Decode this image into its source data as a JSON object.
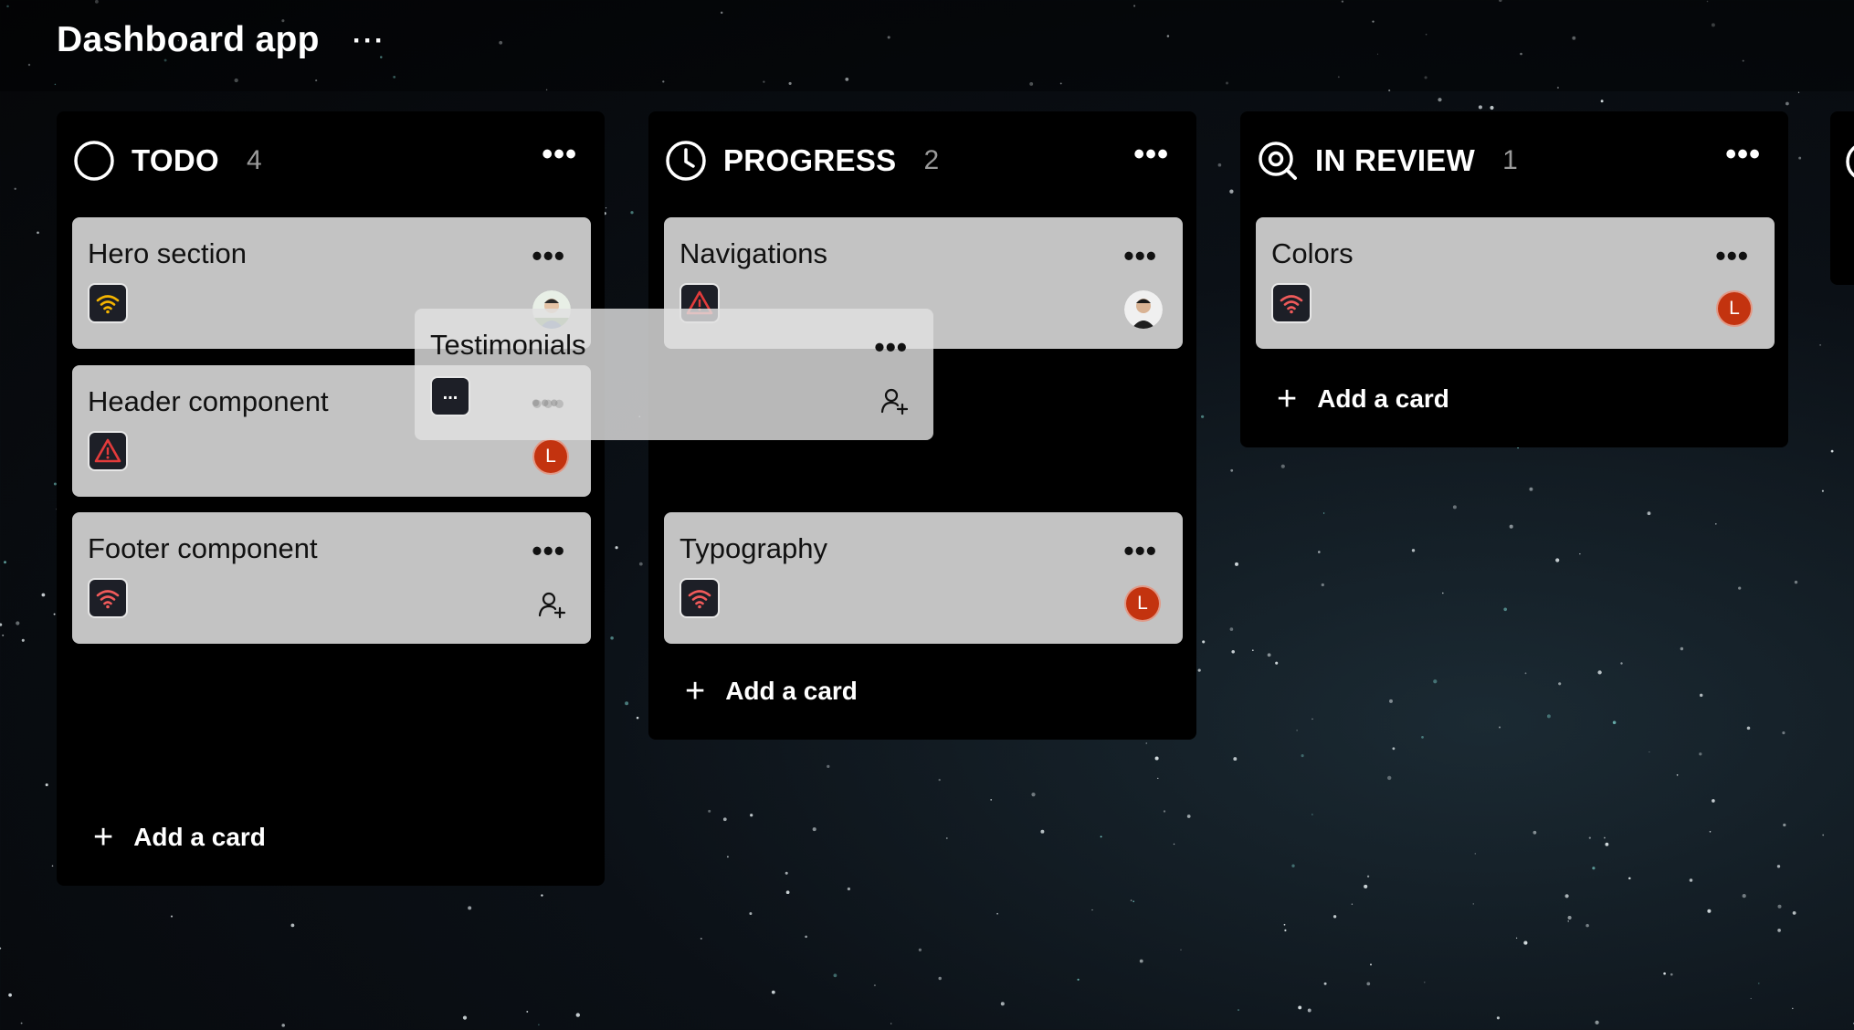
{
  "app": {
    "title": "Dashboard app",
    "more": "···"
  },
  "columns": [
    {
      "name": "TODO",
      "count": "4",
      "icon": "circle-icon",
      "more": "•••",
      "add_label": "Add a card",
      "plus": "+",
      "cards": [
        {
          "title": "Hero section",
          "icon": "wifi-icon",
          "icon_color": "#f4b400",
          "more": "•••",
          "assignee": "photo"
        },
        {
          "title": "Header component",
          "icon": "warning-icon",
          "icon_color": "#e33b3b",
          "more": "•••",
          "assignee": "L"
        },
        {
          "title": "Footer component",
          "icon": "wifi-icon",
          "icon_color": "#f05a5a",
          "more": "•••",
          "assignee": "add-user"
        }
      ]
    },
    {
      "name": "PROGRESS",
      "count": "2",
      "icon": "clock-icon",
      "more": "•••",
      "add_label": "Add a card",
      "plus": "+",
      "cards": [
        {
          "title": "Navigations",
          "icon": "warning-icon",
          "icon_color": "#e33b3b",
          "more": "•••",
          "assignee": "photo"
        },
        {
          "title": "Typography",
          "icon": "wifi-icon",
          "icon_color": "#f05a5a",
          "more": "•••",
          "assignee": "L"
        }
      ]
    },
    {
      "name": "IN REVIEW",
      "count": "1",
      "icon": "search-review-icon",
      "more": "•••",
      "add_label": "Add a card",
      "plus": "+",
      "cards": [
        {
          "title": "Colors",
          "icon": "wifi-icon",
          "icon_color": "#f05a5a",
          "more": "•••",
          "assignee": "L"
        }
      ]
    }
  ],
  "dragging_card": {
    "title": "Testimonials",
    "icon": "dots-icon",
    "icon_text": "...",
    "more": "•••",
    "assignee": "add-user"
  },
  "colors": {
    "avatar": "#c3330f",
    "card_bg": "#c3c3c3",
    "column_bg": "#000000"
  }
}
